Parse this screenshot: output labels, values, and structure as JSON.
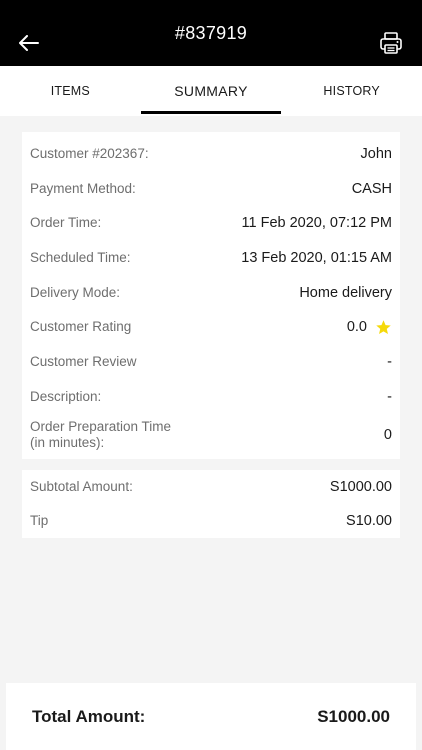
{
  "header": {
    "title": "#837919"
  },
  "tabs": [
    {
      "label": "ITEMS"
    },
    {
      "label": "SUMMARY"
    },
    {
      "label": "HISTORY"
    }
  ],
  "summary": {
    "rows": [
      {
        "label": "Customer #202367:",
        "value": "John"
      },
      {
        "label": "Payment Method:",
        "value": "CASH"
      },
      {
        "label": "Order Time:",
        "value": "11 Feb 2020, 07:12 PM"
      },
      {
        "label": "Scheduled Time:",
        "value": "13 Feb 2020, 01:15 AM"
      },
      {
        "label": "Delivery Mode:",
        "value": "Home delivery"
      },
      {
        "label": "Customer Rating",
        "value": "0.0"
      },
      {
        "label": "Customer Review",
        "value": "-"
      },
      {
        "label": "Description:",
        "value": "-"
      },
      {
        "label": "Order Preparation Time\n(in minutes):",
        "value": "0"
      }
    ]
  },
  "amounts": {
    "rows": [
      {
        "label": "Subtotal Amount:",
        "value": "S1000.00"
      },
      {
        "label": "Tip",
        "value": "S10.00"
      }
    ]
  },
  "total": {
    "label": "Total Amount:",
    "value": "S1000.00"
  },
  "colors": {
    "header_bg": "#000000",
    "star": "#f5d90a",
    "label": "#6e6e6e"
  }
}
